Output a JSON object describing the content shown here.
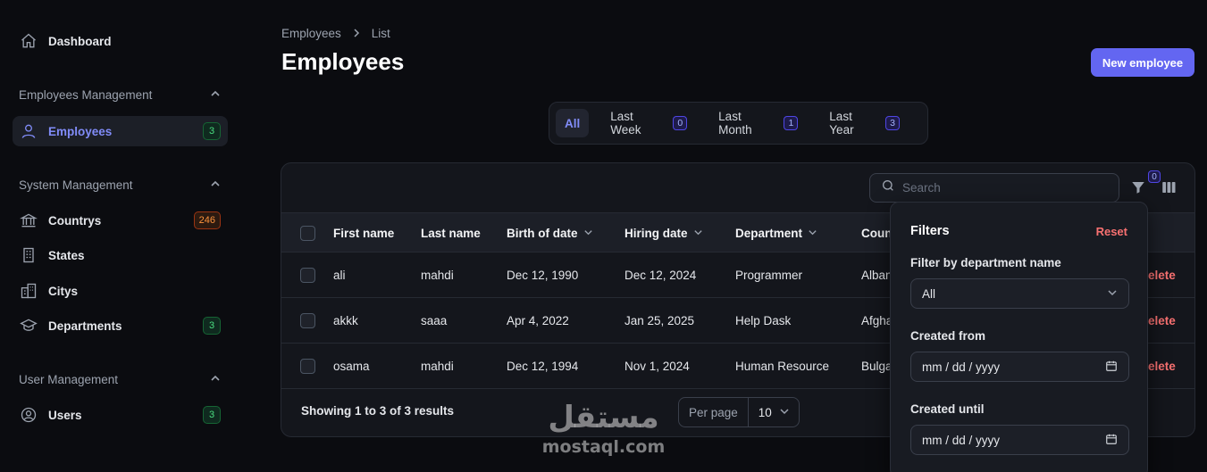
{
  "sidebar": {
    "dashboard": "Dashboard",
    "groups": [
      {
        "title": "Employees Management"
      },
      {
        "title": "System Management"
      },
      {
        "title": "User Management"
      }
    ],
    "items": {
      "employees": {
        "label": "Employees",
        "badge": "3"
      },
      "countrys": {
        "label": "Countrys",
        "badge": "246"
      },
      "states": {
        "label": "States"
      },
      "citys": {
        "label": "Citys"
      },
      "departments": {
        "label": "Departments",
        "badge": "3"
      },
      "users": {
        "label": "Users",
        "badge": "3"
      }
    }
  },
  "breadcrumb": {
    "parent": "Employees",
    "current": "List"
  },
  "page_title": "Employees",
  "new_button": "New employee",
  "tabs": [
    {
      "label": "All"
    },
    {
      "label": "Last Week",
      "count": "0"
    },
    {
      "label": "Last Month",
      "count": "1"
    },
    {
      "label": "Last Year",
      "count": "3"
    }
  ],
  "search": {
    "placeholder": "Search"
  },
  "filter_count": "0",
  "table": {
    "columns": [
      "First name",
      "Last name",
      "Birth of date",
      "Hiring date",
      "Department",
      "Coun"
    ],
    "rows": [
      {
        "first": "ali",
        "last": "mahdi",
        "birth": "Dec 12, 1990",
        "hiring": "Dec 12, 2024",
        "department": "Programmer",
        "country": "Alban",
        "action": "elete"
      },
      {
        "first": "akkk",
        "last": "saaa",
        "birth": "Apr 4, 2022",
        "hiring": "Jan 25, 2025",
        "department": "Help Dask",
        "country": "Afgha",
        "action": "elete"
      },
      {
        "first": "osama",
        "last": "mahdi",
        "birth": "Dec 12, 1994",
        "hiring": "Nov 1, 2024",
        "department": "Human Resource",
        "country": "Bulga",
        "action": "elete"
      }
    ],
    "footer": "Showing 1 to 3 of 3 results",
    "per_page_label": "Per page",
    "per_page_value": "10"
  },
  "filters": {
    "title": "Filters",
    "reset": "Reset",
    "department_label": "Filter by department name",
    "department_value": "All",
    "created_from_label": "Created from",
    "created_from_placeholder": "mm / dd / yyyy",
    "created_until_label": "Created until",
    "created_until_placeholder": "mm / dd / yyyy"
  },
  "watermark": {
    "arabic": "مستقل",
    "latin": "mostaql.com"
  },
  "colors": {
    "accent": "#6366f1",
    "danger": "#f87171",
    "background": "#0b0c10"
  }
}
